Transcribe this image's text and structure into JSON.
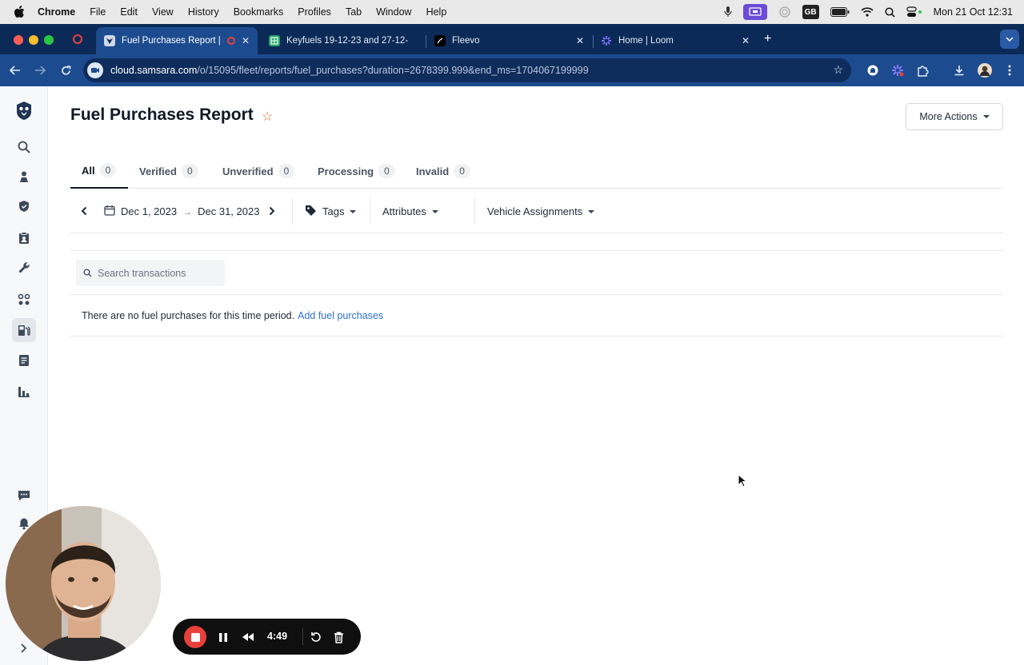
{
  "menubar": {
    "app_name": "Chrome",
    "items": [
      "File",
      "Edit",
      "View",
      "History",
      "Bookmarks",
      "Profiles",
      "Tab",
      "Window",
      "Help"
    ],
    "keyboard_layout": "GB",
    "clock": "Mon 21 Oct  12:31"
  },
  "browser": {
    "tabs": [
      {
        "title": "Fuel Purchases Report | S",
        "favicon": "samsara-icon",
        "active": true
      },
      {
        "title": "Keyfuels 19-12-23 and 27-12-",
        "favicon": "sheets-icon",
        "active": false
      },
      {
        "title": "Fleevo",
        "favicon": "fleevo-icon",
        "active": false
      },
      {
        "title": "Home | Loom",
        "favicon": "loom-icon",
        "active": false
      }
    ],
    "url_host": "cloud.samsara.com",
    "url_path": "/o/15095/fleet/reports/fuel_purchases?duration=2678399.999&end_ms=1704067199999"
  },
  "sidebar": {
    "items": [
      {
        "icon": "samsara-logo-icon"
      },
      {
        "icon": "search-icon"
      },
      {
        "icon": "driver-map-icon"
      },
      {
        "icon": "safety-shield-icon"
      },
      {
        "icon": "compliance-clipboard-icon"
      },
      {
        "icon": "maintenance-wrench-icon"
      },
      {
        "icon": "dispatch-route-icon"
      },
      {
        "icon": "fuel-energy-icon",
        "active": true
      },
      {
        "icon": "documents-icon"
      },
      {
        "icon": "reports-chart-icon"
      },
      {
        "icon": "messages-icon"
      },
      {
        "icon": "alerts-bell-icon"
      },
      {
        "icon": "expand-chevron-icon"
      }
    ]
  },
  "page": {
    "title": "Fuel Purchases Report",
    "more_actions_label": "More Actions"
  },
  "report_tabs": [
    {
      "label": "All",
      "count": "0",
      "active": true
    },
    {
      "label": "Verified",
      "count": "0"
    },
    {
      "label": "Unverified",
      "count": "0"
    },
    {
      "label": "Processing",
      "count": "0"
    },
    {
      "label": "Invalid",
      "count": "0"
    }
  ],
  "filters": {
    "date_start": "Dec 1, 2023",
    "date_arrow": "→",
    "date_end": "Dec 31, 2023",
    "tags_label": "Tags",
    "attributes_label": "Attributes",
    "vehicle_assignments_label": "Vehicle Assignments"
  },
  "search": {
    "placeholder": "Search transactions",
    "value": ""
  },
  "empty_state": {
    "message": "There are no fuel purchases for this time period.",
    "link_label": "Add fuel purchases"
  },
  "recorder": {
    "elapsed": "4:49"
  },
  "colors": {
    "chrome_tabstrip": "#0c2a57",
    "chrome_toolbar": "#1d4b8f",
    "link": "#2f6fd2",
    "favorite_star": "#d2762a",
    "record_red": "#e8413b"
  }
}
